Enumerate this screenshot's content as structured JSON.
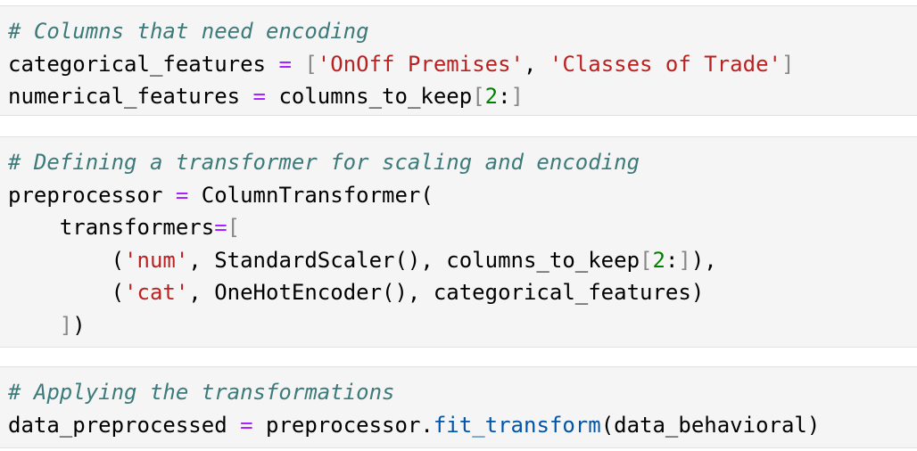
{
  "theme": {
    "cell_background": "#f5f5f5",
    "cell_border": "#e2e2e2",
    "comment_color": "#3d7a7a",
    "string_color": "#ba2121",
    "operator_color": "#aa22ff",
    "number_color": "#008000",
    "function_color": "#0055aa",
    "bracket_color": "#888888",
    "text_color": "#000000"
  },
  "cells": [
    {
      "lines": [
        [
          {
            "t": "# Columns that need encoding",
            "k": "comment"
          }
        ],
        [
          {
            "t": "categorical_features ",
            "k": "plain"
          },
          {
            "t": "=",
            "k": "op"
          },
          {
            "t": " ",
            "k": "plain"
          },
          {
            "t": "[",
            "k": "bracket"
          },
          {
            "t": "'OnOff Premises'",
            "k": "string"
          },
          {
            "t": ", ",
            "k": "plain"
          },
          {
            "t": "'Classes of Trade'",
            "k": "string"
          },
          {
            "t": "]",
            "k": "bracket"
          }
        ],
        [
          {
            "t": "numerical_features ",
            "k": "plain"
          },
          {
            "t": "=",
            "k": "op"
          },
          {
            "t": " columns_to_keep",
            "k": "plain"
          },
          {
            "t": "[",
            "k": "bracket"
          },
          {
            "t": "2",
            "k": "number"
          },
          {
            "t": ":",
            "k": "plain"
          },
          {
            "t": "]",
            "k": "bracket"
          }
        ]
      ]
    },
    {
      "lines": [
        [
          {
            "t": "# Defining a transformer for scaling and encoding",
            "k": "comment"
          }
        ],
        [
          {
            "t": "preprocessor ",
            "k": "plain"
          },
          {
            "t": "=",
            "k": "op"
          },
          {
            "t": " ColumnTransformer(",
            "k": "plain"
          }
        ],
        [
          {
            "t": "    transformers",
            "k": "plain"
          },
          {
            "t": "=",
            "k": "op"
          },
          {
            "t": "[",
            "k": "bracket"
          }
        ],
        [
          {
            "t": "        (",
            "k": "plain"
          },
          {
            "t": "'num'",
            "k": "string"
          },
          {
            "t": ", StandardScaler(), columns_to_keep",
            "k": "plain"
          },
          {
            "t": "[",
            "k": "bracket"
          },
          {
            "t": "2",
            "k": "number"
          },
          {
            "t": ":",
            "k": "plain"
          },
          {
            "t": "]",
            "k": "bracket"
          },
          {
            "t": "),",
            "k": "plain"
          }
        ],
        [
          {
            "t": "        (",
            "k": "plain"
          },
          {
            "t": "'cat'",
            "k": "string"
          },
          {
            "t": ", OneHotEncoder(), categorical_features)",
            "k": "plain"
          }
        ],
        [
          {
            "t": "    ",
            "k": "plain"
          },
          {
            "t": "]",
            "k": "bracket"
          },
          {
            "t": ")",
            "k": "plain"
          }
        ]
      ]
    },
    {
      "lines": [
        [
          {
            "t": "# Applying the transformations",
            "k": "comment"
          }
        ],
        [
          {
            "t": "data_preprocessed ",
            "k": "plain"
          },
          {
            "t": "=",
            "k": "op"
          },
          {
            "t": " preprocessor.",
            "k": "plain"
          },
          {
            "t": "fit_transform",
            "k": "func"
          },
          {
            "t": "(data_behavioral)",
            "k": "plain"
          }
        ]
      ]
    }
  ]
}
